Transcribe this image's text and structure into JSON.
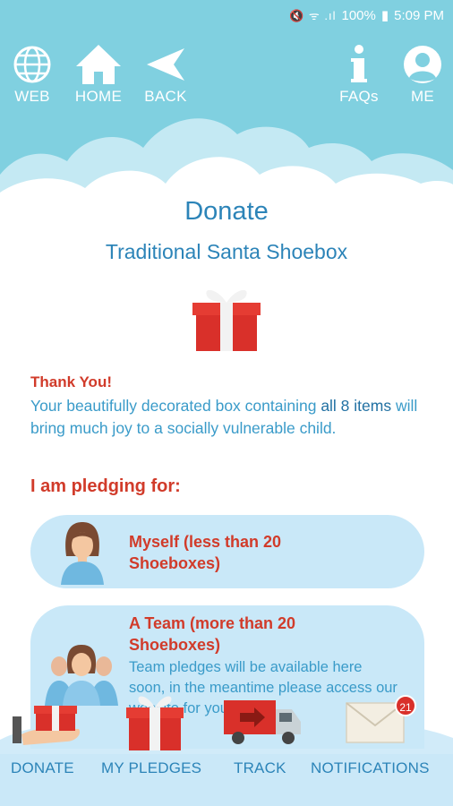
{
  "status_bar": {
    "icons": "🔇 ᯤ .ıl",
    "battery": "100%",
    "time": "5:09 PM"
  },
  "nav": {
    "web": "WEB",
    "home": "HOME",
    "back": "BACK",
    "faqs": "FAQs",
    "me": "ME"
  },
  "page": {
    "title": "Donate",
    "subtitle": "Traditional Santa Shoebox"
  },
  "thanks": {
    "heading": "Thank You!",
    "body_pre": "Your beautifully decorated box containing ",
    "body_highlight": "all 8 items",
    "body_post": " will bring much joy to a socially vulnerable child."
  },
  "pledge": {
    "heading": "I am pledging for:",
    "options": [
      {
        "title": "Myself (less than 20 Shoeboxes)"
      },
      {
        "title": "A Team (more than 20 Shoeboxes)",
        "description": "Team pledges will be available here soon, in the meantime please access our website for your"
      }
    ]
  },
  "tabs": {
    "donate": "DONATE",
    "my_pledges": "MY PLEDGES",
    "track": "TRACK",
    "notifications": "NOTIFICATIONS",
    "notification_count": "21"
  },
  "colors": {
    "header": "#80d0e0",
    "primary_text": "#2c84b8",
    "accent_red": "#d13b2a",
    "option_bg": "#c9e8f8"
  }
}
